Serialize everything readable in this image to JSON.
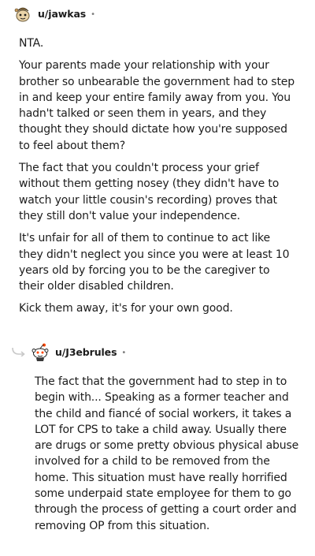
{
  "comments": [
    {
      "username": "u/jawkas",
      "separator": "•",
      "avatar_icon": "snoo-avatar-icon",
      "paragraphs": [
        "NTA.",
        "Your parents made your relationship with your brother so unbearable the government had to step in and keep your entire family away from you. You hadn't talked or seen them in years, and they thought they should dictate how you're supposed to feel about them?",
        "The fact that you couldn't process your grief without them getting nosey (they didn't have to watch your little cousin's recording) proves that they still don't value your independence.",
        "It's unfair for all of them to continue to act like they didn't neglect you since you were at least 10 years old by forcing you to be the caregiver to their older disabled children.",
        "Kick them away, it's for your own good."
      ]
    },
    {
      "username": "u/J3ebrules",
      "separator": "•",
      "avatar_icon": "snoo-avatar-icon",
      "reply_icon": "reply-arrow-icon",
      "paragraphs": [
        "The fact that the government had to step in to begin with... Speaking as a former teacher and the child and fiancé of social workers, it takes a LOT for CPS to take a child away. Usually there are drugs or some pretty obvious physical abuse involved for a child to be removed from the home. This situation must have really horrified some underpaid state employee for them to go through the process of getting a court order and removing OP from this situation."
      ]
    }
  ],
  "colors": {
    "text": "#1c1c1c",
    "meta": "#7c7c7c",
    "reply_line": "#c8c8c8"
  }
}
